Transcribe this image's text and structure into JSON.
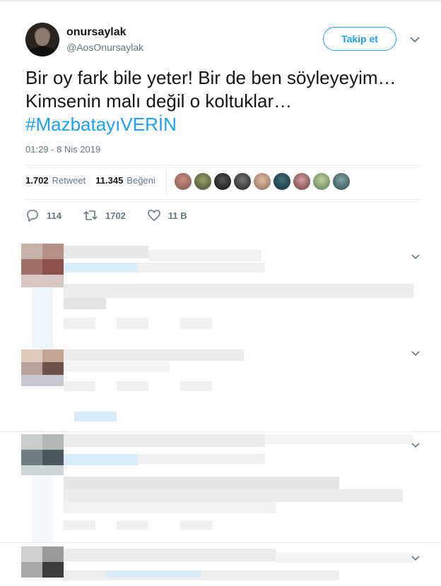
{
  "user": {
    "name": "onursaylak",
    "handle": "@AosOnursaylak"
  },
  "follow_label": "Takip et",
  "tweet": {
    "line1": "Bir oy fark bile yeter! Bir de ben söyleyeyim…",
    "line2": "Kimsenin malı değil o koltuklar…",
    "hashtag": "#MazbatayıVERİN",
    "timestamp": "01:29 - 8 Nis 2019"
  },
  "stats": {
    "retweet_count": "1.702",
    "retweet_label": "Retweet",
    "like_count": "11.345",
    "like_label": "Beğeni"
  },
  "actions": {
    "replies": "114",
    "retweets": "1702",
    "likes": "11 B"
  },
  "icons": [
    "chevron-down-icon",
    "reply-icon",
    "retweet-icon",
    "heart-icon"
  ],
  "colors": {
    "accent": "#1da1f2",
    "text": "#14171a",
    "muted": "#657786",
    "border": "#e6ecf0"
  }
}
